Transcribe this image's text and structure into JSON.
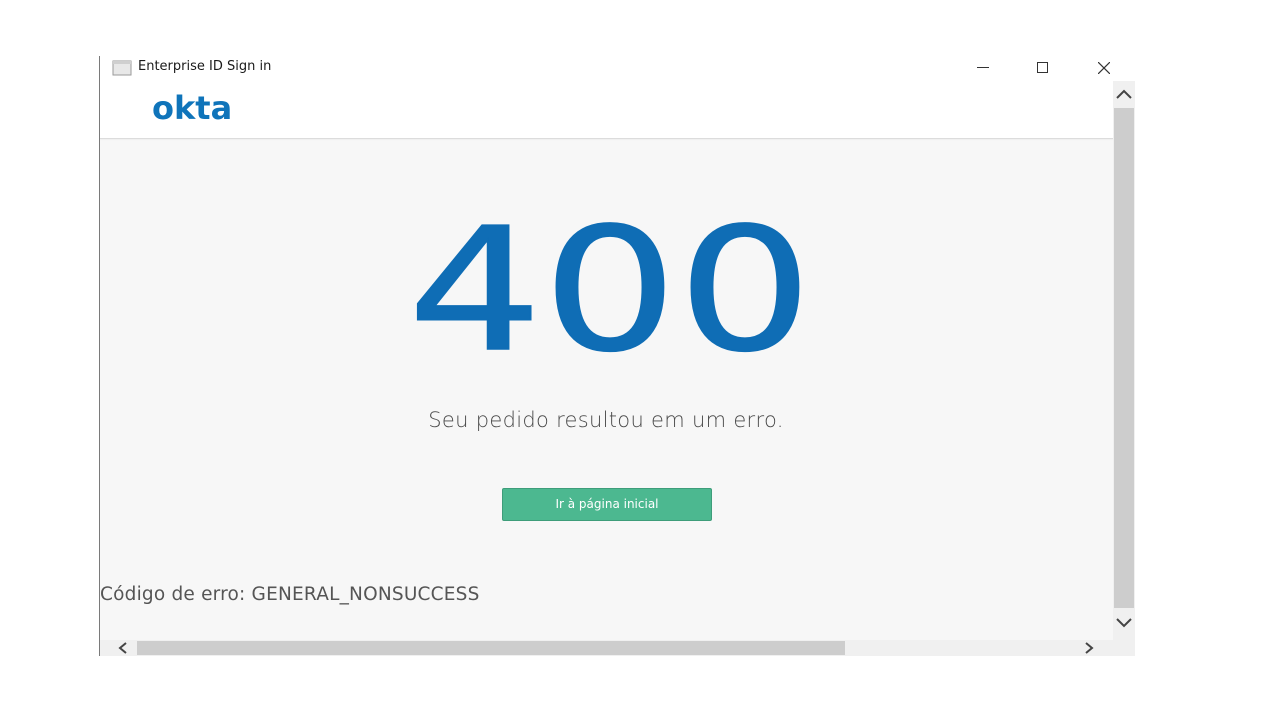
{
  "window": {
    "title": "Enterprise ID Sign in",
    "icons": {
      "app": "window-app-icon",
      "minimize": "minimize-icon",
      "maximize": "maximize-icon",
      "close": "close-icon"
    }
  },
  "header": {
    "logo_text": "okta"
  },
  "error": {
    "code": "400",
    "message": "Seu pedido resultou em um erro.",
    "button_label": "Ir à página inicial",
    "details": "Código de erro: GENERAL_NONSUCCESS"
  },
  "colors": {
    "brand": "#0f74ba",
    "button": "#4cb890",
    "background": "#f7f7f7"
  }
}
